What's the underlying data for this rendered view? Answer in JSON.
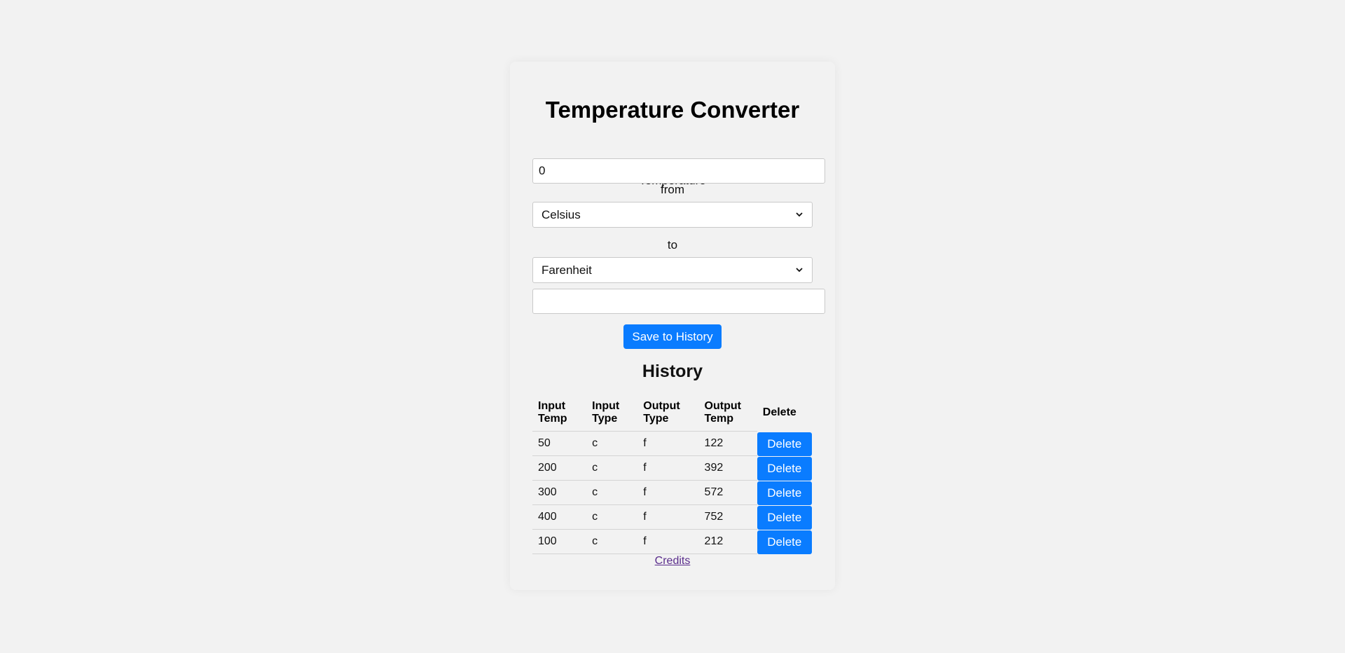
{
  "page": {
    "title": "Temperature Converter"
  },
  "form": {
    "temperature_label": "Temperature",
    "temperature_value": "0",
    "from_label": "from",
    "from_selected": "Celsius",
    "to_label": "to",
    "to_selected": "Farenheit",
    "result_value": "",
    "save_label": "Save to History"
  },
  "history": {
    "title": "History",
    "columns": [
      "Input Temp",
      "Input Type",
      "Output Type",
      "Output Temp",
      "Delete"
    ],
    "rows": [
      {
        "input_temp": "50",
        "input_type": "c",
        "output_type": "f",
        "output_temp": "122",
        "delete_label": "Delete"
      },
      {
        "input_temp": "200",
        "input_type": "c",
        "output_type": "f",
        "output_temp": "392",
        "delete_label": "Delete"
      },
      {
        "input_temp": "300",
        "input_type": "c",
        "output_type": "f",
        "output_temp": "572",
        "delete_label": "Delete"
      },
      {
        "input_temp": "400",
        "input_type": "c",
        "output_type": "f",
        "output_temp": "752",
        "delete_label": "Delete"
      },
      {
        "input_temp": "100",
        "input_type": "c",
        "output_type": "f",
        "output_temp": "212",
        "delete_label": "Delete"
      }
    ]
  },
  "footer": {
    "credits_label": "Credits"
  },
  "colors": {
    "accent": "#0a7cff",
    "background": "#f2f2f2",
    "link": "#5a2d8c"
  },
  "icons": {
    "select_arrow": "chevron-down-icon"
  }
}
